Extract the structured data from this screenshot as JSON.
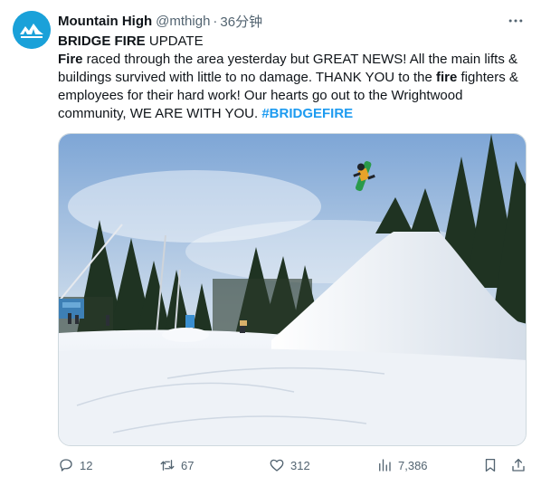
{
  "author": {
    "display_name": "Mountain High",
    "handle": "@mthigh",
    "separator": "·",
    "time": "36分钟",
    "avatar_icon": "mountain-high-logo"
  },
  "tweet": {
    "parts": [
      {
        "text": "BRIDGE FIRE",
        "style": "bold"
      },
      {
        "text": " UPDATE",
        "style": "normal"
      },
      {
        "text": "\n",
        "style": "break"
      },
      {
        "text": "Fire",
        "style": "bold"
      },
      {
        "text": " raced through the area yesterday but GREAT NEWS! All the main lifts & buildings survived with little to no damage. THANK YOU to the ",
        "style": "normal"
      },
      {
        "text": "fire",
        "style": "bold"
      },
      {
        "text": " fighters & employees for their hard work! Our hearts go out to the Wrightwood community, WE ARE WITH YOU. ",
        "style": "normal"
      },
      {
        "text": "#BRIDGEFIRE",
        "style": "hashtag"
      }
    ]
  },
  "media": {
    "description_icon": "snowboard-jump-photo"
  },
  "actions": {
    "replies": "12",
    "retweets": "67",
    "likes": "312",
    "views": "7,386"
  },
  "colors": {
    "accent": "#1d9bf0",
    "text": "#0f1419",
    "muted": "#536471",
    "avatar_bg": "#1aa1d9"
  }
}
